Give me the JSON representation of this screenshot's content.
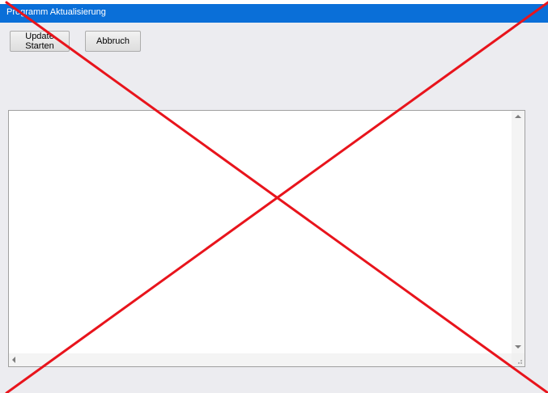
{
  "window": {
    "title": "Programm Aktualisierung",
    "title_bar_color": "#0a6fd8"
  },
  "toolbar": {
    "start_label": "Update Starten",
    "cancel_label": "Abbruch"
  },
  "log": {
    "content": ""
  },
  "overlay": {
    "mark": "red-x-cross",
    "color": "#e8141c"
  }
}
